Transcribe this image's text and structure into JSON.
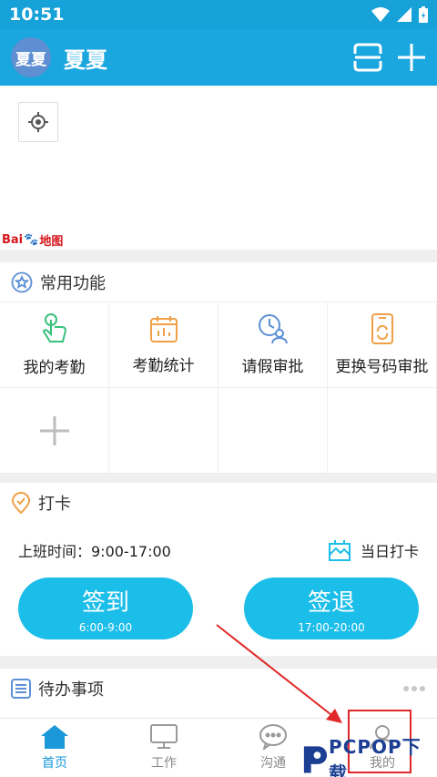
{
  "status_bar": {
    "time": "10:51"
  },
  "header": {
    "avatar_text": "夏夏",
    "user_name": "夏夏"
  },
  "common_functions": {
    "title": "常用功能",
    "items": [
      {
        "label": "我的考勤",
        "icon": "touch-icon"
      },
      {
        "label": "考勤统计",
        "icon": "calendar-chart-icon"
      },
      {
        "label": "请假审批",
        "icon": "clock-user-icon"
      },
      {
        "label": "更换号码审批",
        "icon": "phone-refresh-icon"
      }
    ]
  },
  "clock_in": {
    "title": "打卡",
    "work_hours_label": "上班时间：9:00-17:00",
    "today_label": "当日打卡",
    "sign_in": {
      "label": "签到",
      "time": "6:00-9:00"
    },
    "sign_out": {
      "label": "签退",
      "time": "17:00-20:00"
    }
  },
  "todo": {
    "title": "待办事项"
  },
  "tabs": [
    {
      "label": "首页",
      "icon": "home-icon",
      "active": true
    },
    {
      "label": "工作",
      "icon": "monitor-icon",
      "active": false
    },
    {
      "label": "沟通",
      "icon": "chat-icon",
      "active": false
    },
    {
      "label": "我的",
      "icon": "user-icon",
      "active": false
    }
  ],
  "map": {
    "logo_text_1": "Bai",
    "logo_text_2": "地图"
  },
  "watermark": {
    "text": "PCPOP下载"
  },
  "colors": {
    "primary": "#1aa6de",
    "button": "#1bbde9",
    "active_tab": "#1a98d9",
    "accent_orange": "#f0a047",
    "highlight": "#e12828"
  }
}
